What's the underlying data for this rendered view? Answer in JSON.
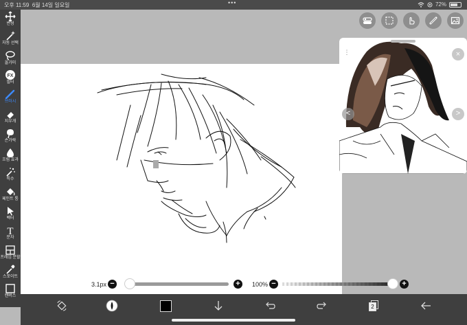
{
  "status": {
    "time": "오후 11:59",
    "date": "6월 14일 일요일",
    "battery": "72%",
    "battery_level": 0.72
  },
  "toolbar": {
    "tools": [
      {
        "label": "변형",
        "icon": "move-icon"
      },
      {
        "label": "자동 선택",
        "icon": "magic-wand-icon"
      },
      {
        "label": "올가미",
        "icon": "lasso-icon"
      },
      {
        "label": "필터",
        "icon": "fx-icon"
      },
      {
        "label": "브러시",
        "icon": "brush-icon",
        "active": true
      },
      {
        "label": "지우개",
        "icon": "eraser-icon"
      },
      {
        "label": "손가락",
        "icon": "smudge-icon"
      },
      {
        "label": "흐림 효과",
        "icon": "blur-drop-icon"
      },
      {
        "label": "특수",
        "icon": "special-wand-icon"
      },
      {
        "label": "페인트 통",
        "icon": "paint-bucket-icon"
      },
      {
        "label": "벡터",
        "icon": "vector-cursor-icon"
      },
      {
        "label": "문자",
        "icon": "text-icon"
      },
      {
        "label": "프레임 분할",
        "icon": "frame-divider-icon"
      },
      {
        "label": "스포이트",
        "icon": "eyedropper-icon"
      },
      {
        "label": "캔버스",
        "icon": "canvas-icon"
      }
    ]
  },
  "brush": {
    "size_label": "3.1px",
    "size_minus": "−",
    "size_plus": "+",
    "size_value": 0.02,
    "opacity_label": "100%",
    "opacity_minus": "−",
    "opacity_plus": "+",
    "opacity_value": 1.0
  },
  "reference": {
    "close": "×",
    "prev": "<",
    "next": ">",
    "menu": "⋮"
  },
  "bottombar": {
    "layer_count": "2",
    "current_color": "#000000"
  },
  "colors": {
    "toolbar_bg": "#3f3f3f",
    "workspace_bg": "#b9b9b9",
    "active_accent": "#3d8bff"
  }
}
